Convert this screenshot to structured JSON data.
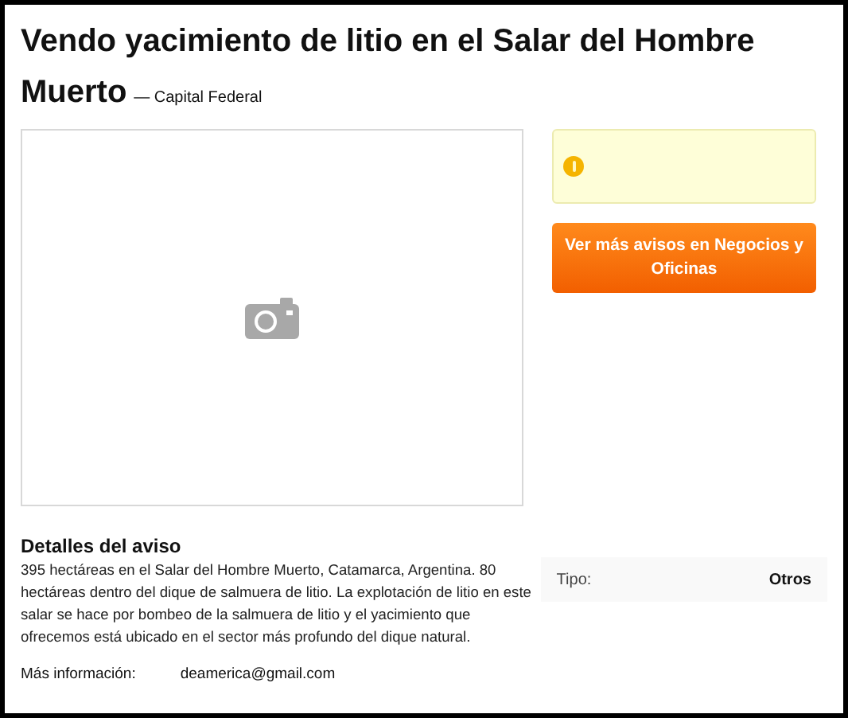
{
  "title": "Vendo yacimiento de litio en el Salar del Hombre Muerto",
  "location": "— Capital Federal",
  "notice": {
    "kind": "warning"
  },
  "button": "Ver más avisos en Negocios y Oficinas",
  "details": {
    "heading": "Detalles del aviso",
    "text": "395 hectáreas en el Salar del Hombre Muerto, Catamarca, Argentina. 80 hectáreas dentro del dique de salmuera de litio. La explotación de litio en este salar se hace por bombeo de la salmuera de litio y el yacimiento que ofrecemos está ubicado en el sector más profundo del dique natural.",
    "more_label": "Más información:",
    "more_value": "deamerica@gmail.com"
  },
  "attributes": [
    {
      "label": "Tipo:",
      "value": "Otros"
    }
  ]
}
